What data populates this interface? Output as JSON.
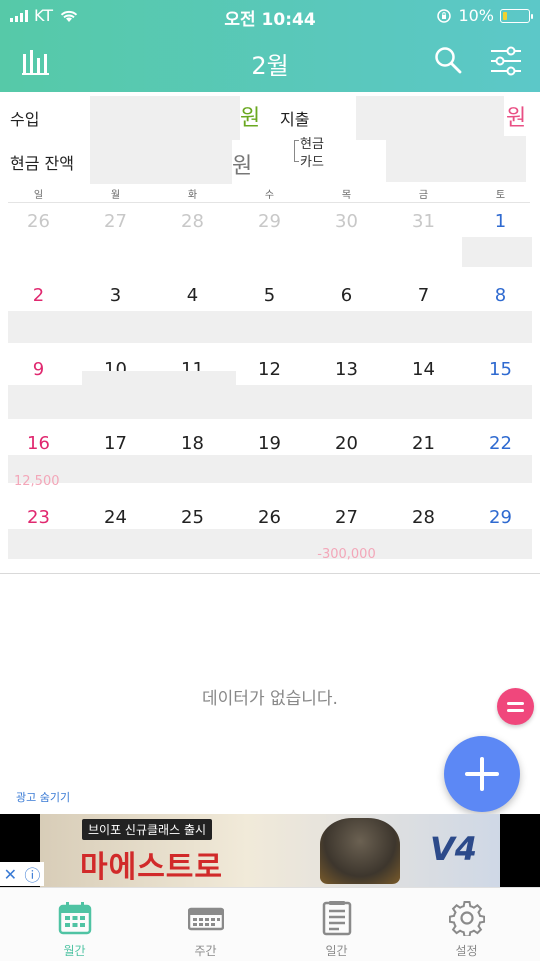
{
  "status": {
    "carrier": "KT",
    "time": "오전 10:44",
    "battery": "10%"
  },
  "header": {
    "title": "2월"
  },
  "summary": {
    "income_label": "수입",
    "income_unit": "원",
    "expense_label": "지출",
    "expense_unit": "원",
    "cash_balance_label": "현금 잔액",
    "cash_balance_unit": "원",
    "cash_label": "현금",
    "card_label": "카드"
  },
  "weekdays": [
    "일",
    "월",
    "화",
    "수",
    "목",
    "금",
    "토"
  ],
  "calendar": {
    "rows": [
      [
        "26",
        "27",
        "28",
        "29",
        "30",
        "31",
        "1"
      ],
      [
        "2",
        "3",
        "4",
        "5",
        "6",
        "7",
        "8"
      ],
      [
        "9",
        "10",
        "11",
        "12",
        "13",
        "14",
        "15"
      ],
      [
        "16",
        "17",
        "18",
        "19",
        "20",
        "21",
        "22"
      ],
      [
        "23",
        "24",
        "25",
        "26",
        "27",
        "28",
        "29"
      ]
    ],
    "visible_amounts": {
      "row4_sun": "12,500",
      "row5_thu": "-300,000"
    }
  },
  "empty_message": "데이터가 없습니다.",
  "hide_ad_label": "광고 숨기기",
  "ad": {
    "tag": "브이포 신규클래스 출시",
    "brand": "마에스트로",
    "logo": "V4",
    "close": "✕",
    "info": "ⓘ"
  },
  "tabs": [
    {
      "label": "월간",
      "icon": "calendar-month-icon",
      "active": true
    },
    {
      "label": "주간",
      "icon": "calendar-week-icon",
      "active": false
    },
    {
      "label": "일간",
      "icon": "notepad-icon",
      "active": false
    },
    {
      "label": "설정",
      "icon": "gear-icon",
      "active": false
    }
  ],
  "colors": {
    "accent": "#4fc3a3",
    "sunday": "#e0286f",
    "saturday": "#2f6ad0",
    "fab": "#5c88f5",
    "fab_small": "#f0477c"
  }
}
